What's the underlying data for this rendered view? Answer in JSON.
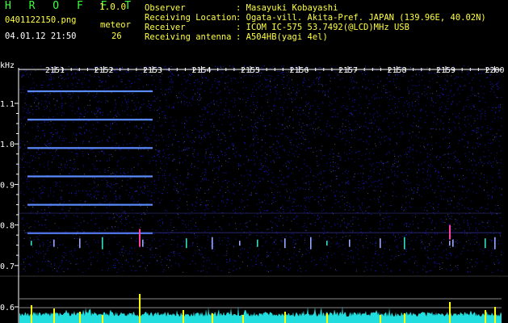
{
  "header": {
    "app_name": "H R O F F T",
    "version": "1.0.0",
    "filename": "0401122150.png",
    "datetime": "04.01.12 21:50",
    "meteor_label": "meteor",
    "meteor_count": "26"
  },
  "info": [
    {
      "key": "Observer",
      "value": ": Masayuki Kobayashi"
    },
    {
      "key": "Receiving Location",
      "value": ": Ogata-vill. Akita-Pref. JAPAN (139.96E, 40.02N)"
    },
    {
      "key": "Receiver",
      "value": ": ICOM IC-575 53.7492(@LCD)MHz USB"
    },
    {
      "key": "Receiving antenna",
      "value": ": A504HB(yagi 4el)"
    }
  ],
  "colors": {
    "axis": "#ffffff",
    "header_text": "#ffff40",
    "title": "#3cff3c",
    "tone": "#5a8cff",
    "spike": "#ffff00",
    "echo_level": "#22dddd",
    "noise_blue": "#1a1ad8"
  },
  "chart_data": {
    "type": "heatmap",
    "y_unit_label": "kHz",
    "y_ticks": [
      "1.1",
      "1.0",
      "0.9",
      "0.8",
      "0.7"
    ],
    "y_ticks_lower": [
      "0.6"
    ],
    "x_ticks": [
      "2151",
      "2152",
      "2153",
      "2154",
      "2155",
      "2156",
      "2157",
      "2158",
      "2159",
      "2200"
    ],
    "tone_freqs_khz": [
      1.13,
      1.06,
      0.99,
      0.92,
      0.85,
      0.78
    ],
    "tone_end_time": "2153",
    "meteor_echo_times": [
      "2150",
      "2151",
      "2152",
      "2153",
      "2154",
      "2155",
      "2156",
      "2157",
      "2158",
      "2159",
      "2200"
    ]
  }
}
